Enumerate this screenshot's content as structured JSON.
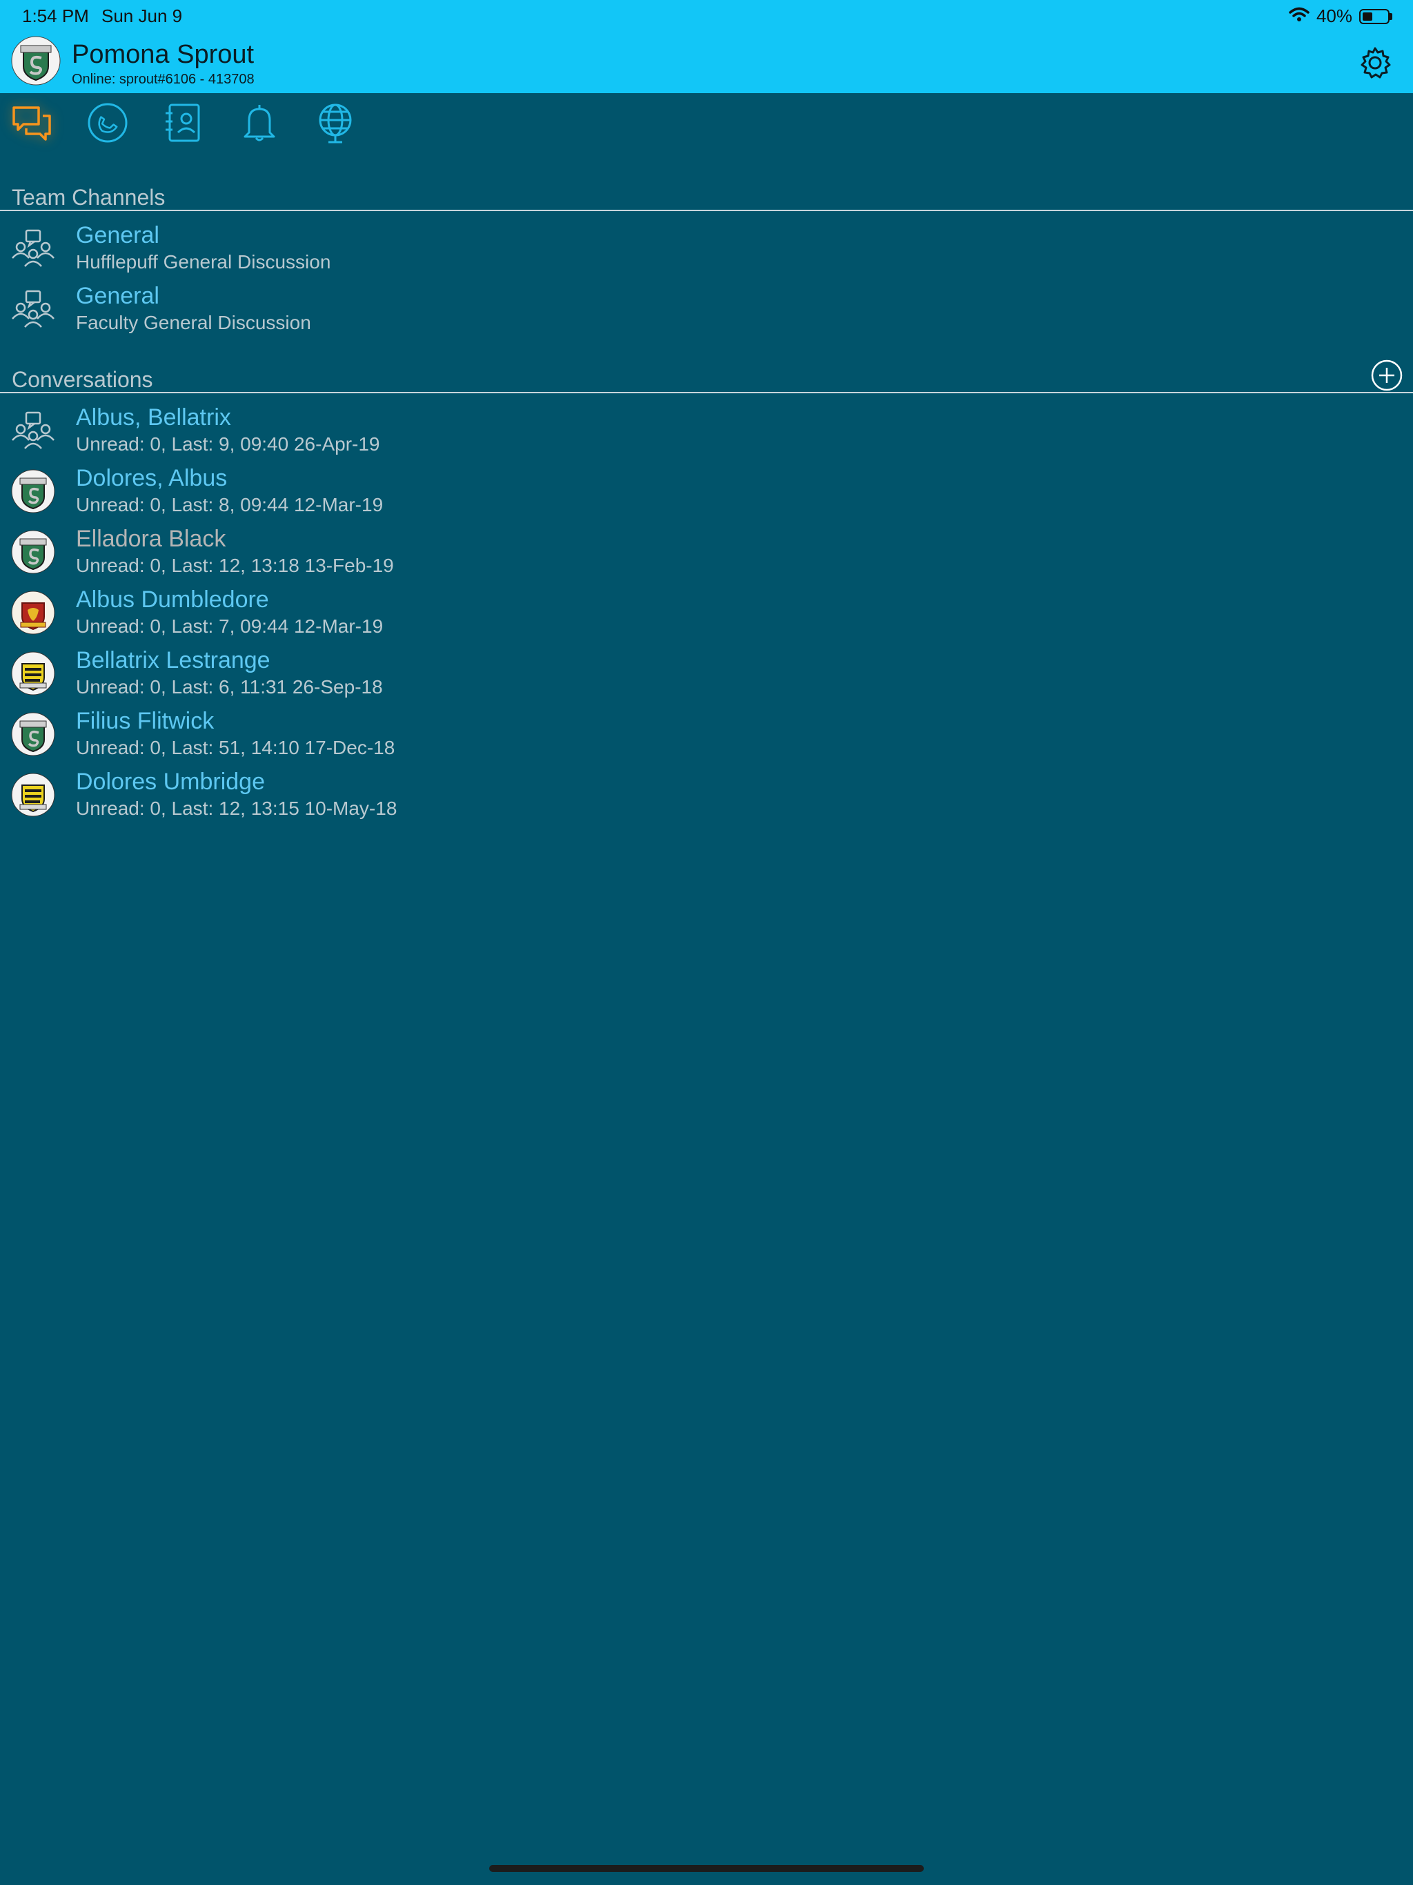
{
  "status_bar": {
    "time": "1:54 PM",
    "date": "Sun Jun 9",
    "battery": "40%",
    "battery_level": 0.4
  },
  "header": {
    "name": "Pomona Sprout",
    "status": "Online: sprout#6106 - 413708",
    "avatar": "slytherin-crest"
  },
  "tabs": [
    {
      "name": "chats",
      "icon": "chat-bubbles-icon",
      "active": true
    },
    {
      "name": "calls",
      "icon": "phone-icon",
      "active": false
    },
    {
      "name": "contacts",
      "icon": "contacts-icon",
      "active": false
    },
    {
      "name": "notifications",
      "icon": "bell-icon",
      "active": false
    },
    {
      "name": "world",
      "icon": "globe-icon",
      "active": false
    }
  ],
  "team_channels": {
    "title": "Team Channels",
    "items": [
      {
        "name": "General",
        "subtitle": "Hufflepuff General Discussion",
        "icon": "group-icon"
      },
      {
        "name": "General",
        "subtitle": "Faculty General Discussion",
        "icon": "group-icon"
      }
    ]
  },
  "conversations": {
    "title": "Conversations",
    "items": [
      {
        "name": "Albus, Bellatrix",
        "subtitle": "Unread: 0, Last: 9, 09:40 26-Apr-19",
        "icon": "group-icon",
        "muted": false
      },
      {
        "name": "Dolores, Albus",
        "subtitle": "Unread: 0, Last: 8, 09:44 12-Mar-19",
        "icon": "slytherin-crest",
        "muted": false
      },
      {
        "name": "Elladora Black",
        "subtitle": "Unread: 0, Last: 12, 13:18 13-Feb-19",
        "icon": "slytherin-crest",
        "muted": true
      },
      {
        "name": "Albus Dumbledore",
        "subtitle": "Unread: 0, Last: 7, 09:44 12-Mar-19",
        "icon": "gryffindor-crest",
        "muted": false
      },
      {
        "name": "Bellatrix Lestrange",
        "subtitle": "Unread: 0, Last: 6, 11:31 26-Sep-18",
        "icon": "hufflepuff-crest",
        "muted": false
      },
      {
        "name": "Filius Flitwick",
        "subtitle": "Unread: 0, Last: 51, 14:10 17-Dec-18",
        "icon": "slytherin-crest",
        "muted": false
      },
      {
        "name": "Dolores Umbridge",
        "subtitle": "Unread: 0, Last: 12, 13:15 10-May-18",
        "icon": "hufflepuff-crest",
        "muted": false
      }
    ]
  },
  "colors": {
    "header_bg": "#12c6f7",
    "body_bg": "#01546b",
    "accent_blue": "#5ec8f2",
    "active_tab": "#f7941d",
    "muted_text": "#b9c9d0"
  }
}
